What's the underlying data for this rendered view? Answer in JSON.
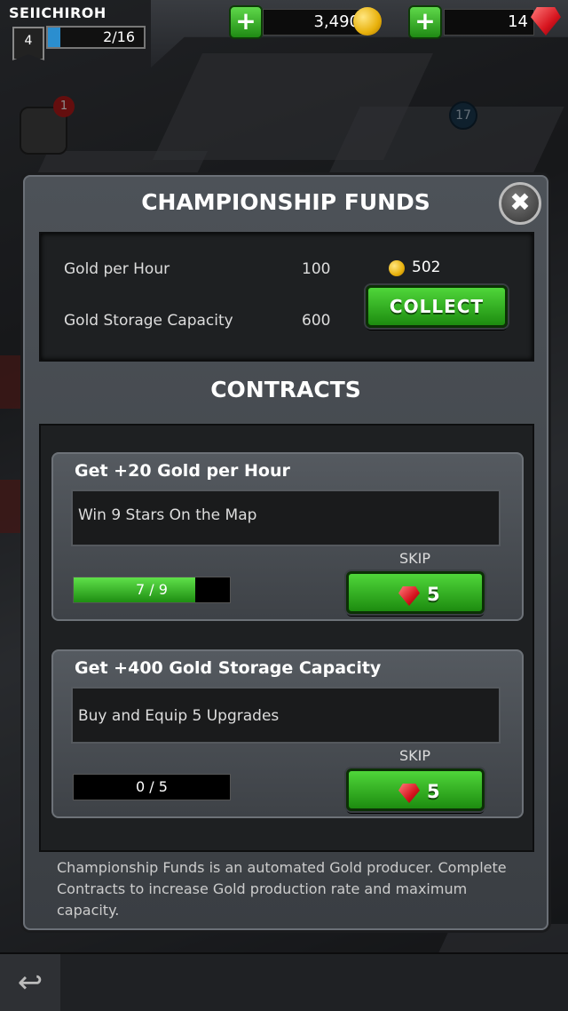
{
  "hud": {
    "player_name": "SEIICHIROH",
    "level": "4",
    "xp_text": "2/16",
    "xp_fraction": 0.125,
    "gold_amount": "3,490",
    "gems_amount": "14",
    "notification_count": "1",
    "map_node_label": "17"
  },
  "modal": {
    "title": "CHAMPIONSHIP FUNDS",
    "close_symbol": "✖",
    "funds": {
      "gold_per_hour_label": "Gold per Hour",
      "gold_per_hour_value": "100",
      "storage_label": "Gold Storage Capacity",
      "storage_value": "600",
      "stored_amount": "502",
      "collect_label": "COLLECT"
    },
    "contracts_title": "CONTRACTS",
    "contracts": [
      {
        "title": "Get +20 Gold per Hour",
        "description": "Win 9 Stars On the Map",
        "progress_text": "7 / 9",
        "progress_fraction": 0.778,
        "skip_label": "SKIP",
        "skip_cost": "5"
      },
      {
        "title": "Get +400 Gold Storage Capacity",
        "description": "Buy and Equip 5 Upgrades",
        "progress_text": "0 / 5",
        "progress_fraction": 0,
        "skip_label": "SKIP",
        "skip_cost": "5"
      }
    ],
    "footer": "Championship Funds is an automated Gold producer. Complete Contracts to increase Gold production rate and maximum capacity."
  },
  "bottom_bar": {
    "back_symbol": "↩"
  },
  "colors": {
    "accent_green": "#3fbf2a",
    "gem_red": "#d6141e",
    "gold": "#e8b10c",
    "xp_blue": "#2b8ecf"
  }
}
